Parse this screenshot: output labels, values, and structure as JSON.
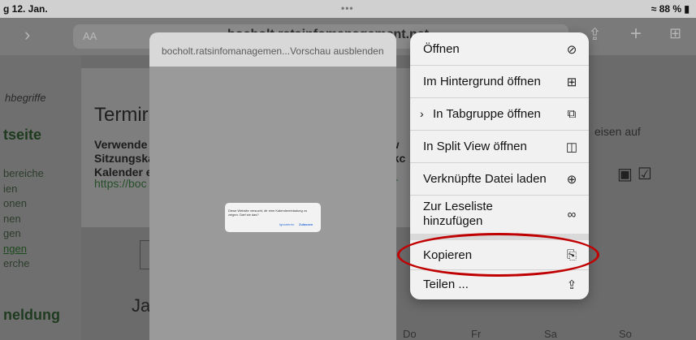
{
  "status_bar": {
    "time": "g 12. Jan.",
    "dots": "•••",
    "battery": "≈ 88 % ▮"
  },
  "toolbar": {
    "back": "›",
    "aa": "AA",
    "host": "bocholt.ratsinfomanagement.net",
    "share": "⇪",
    "plus": "+",
    "tabs": "⊞"
  },
  "sidebar": {
    "search_placeholder": "hbegriffe",
    "heading_top": "tseite",
    "items": [
      "bereiche",
      "ien",
      "onen",
      "nen",
      "gen",
      "ngen",
      "erche"
    ],
    "heading_bottom": "neldung"
  },
  "dialog": {
    "title": "Termir",
    "body_line1": "Verwende",
    "body_line2": "Sitzungska",
    "body_line3": "Kalender e",
    "link": "https://boc",
    "right_line1": "nw",
    "right_line2": "e kc",
    "right_link": "ET"
  },
  "background": {
    "right_text": "eisen auf",
    "month": "Ja",
    "weekdays": [
      "Do",
      "Fr",
      "Sa",
      "So"
    ]
  },
  "preview": {
    "header": "bocholt.ratsinfomanagemen...Vorschau ausblenden",
    "alert_message": "Diese Website versucht, dir eine Kalendereinladung zu zeigen. Darf sie das?",
    "alert_ignore": "Ignorieren",
    "alert_allow": "Zulassen"
  },
  "menu": {
    "items": [
      {
        "label": "Öffnen",
        "icon": "⊘"
      },
      {
        "label": "Im Hintergrund öffnen",
        "icon": "⊞"
      },
      {
        "label": "In Tabgruppe öffnen",
        "icon": "⧉",
        "chevron": "›"
      },
      {
        "label": "In Split View öffnen",
        "icon": "◫"
      },
      {
        "label": "Verknüpfte Datei laden",
        "icon": "⊕"
      },
      {
        "label": "Zur Leseliste",
        "label2": "hinzufügen",
        "icon": "∞"
      },
      {
        "label": "Kopieren",
        "icon": "⎘"
      },
      {
        "label": "Teilen ...",
        "icon": "⇪"
      }
    ]
  },
  "colors": {
    "highlight": "#c00000",
    "menu_bg": "#f1f1f1"
  }
}
